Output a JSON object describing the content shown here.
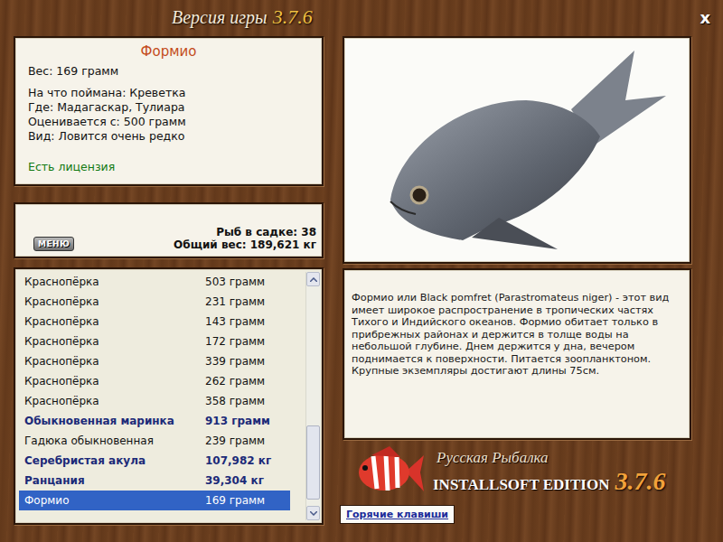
{
  "window": {
    "title": "Версия игры",
    "version": "3.7.6",
    "close": "x"
  },
  "fish_card": {
    "name": "Формио",
    "weight": "Вес: 169 грамм",
    "lines": [
      "На что поймана: Креветка",
      "Где: Мадагаскар, Тулиара",
      "Оценивается с: 500 грамм",
      "Вид: Ловится очень редко"
    ],
    "license": "Есть лицензия"
  },
  "stats": {
    "menu_button": "МЕНЮ",
    "count": "Рыб в садке: 38",
    "total": "Общий вес: 189,621 кг"
  },
  "catch_list": {
    "rows": [
      {
        "name": "Краснопёрка",
        "weight": "503 грамм",
        "bold": false,
        "selected": false
      },
      {
        "name": "Краснопёрка",
        "weight": "231 грамм",
        "bold": false,
        "selected": false
      },
      {
        "name": "Краснопёрка",
        "weight": "143 грамм",
        "bold": false,
        "selected": false
      },
      {
        "name": "Краснопёрка",
        "weight": "172 грамм",
        "bold": false,
        "selected": false
      },
      {
        "name": "Краснопёрка",
        "weight": "339 грамм",
        "bold": false,
        "selected": false
      },
      {
        "name": "Краснопёрка",
        "weight": "262 грамм",
        "bold": false,
        "selected": false
      },
      {
        "name": "Краснопёрка",
        "weight": "358 грамм",
        "bold": false,
        "selected": false
      },
      {
        "name": "Обыкновенная маринка",
        "weight": "913 грамм",
        "bold": true,
        "selected": false
      },
      {
        "name": "Гадюка обыкновенная",
        "weight": "239 грамм",
        "bold": false,
        "selected": false
      },
      {
        "name": "Серебристая акула",
        "weight": "107,982 кг",
        "bold": true,
        "selected": false
      },
      {
        "name": "Ранцания",
        "weight": "39,304 кг",
        "bold": true,
        "selected": false
      },
      {
        "name": "Формио",
        "weight": "169 грамм",
        "bold": false,
        "selected": true
      }
    ],
    "scrollbar": {
      "level": 1
    }
  },
  "description": "Формио или Black pomfret (Parastromateus niger) - этот вид имеет широкое распространение в тропических частях Тихого и Индийского океанов. Формио обитает только в прибрежных районах и держится в толще воды на небольшой глубине. Днем держится у дна, вечером поднимается к поверхности. Питается зоопланктоном. Крупные экземпляры достигают длины 75см.",
  "logo": {
    "title": "Русская Рыбалка",
    "edition": "INSTALLSOFT EDITION",
    "version": "3.7.6"
  },
  "hotkeys_button": "Горячие клавиши"
}
